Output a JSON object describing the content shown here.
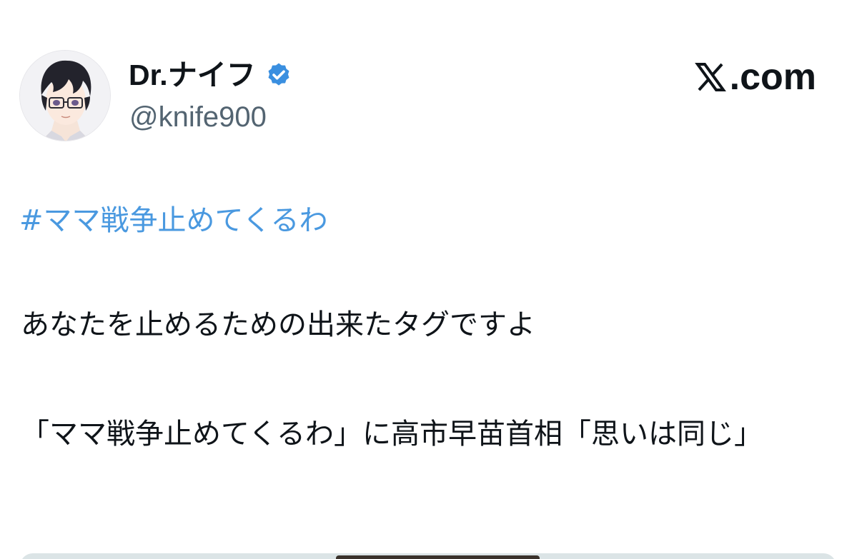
{
  "tweet": {
    "author": {
      "display_name": "Dr.ナイフ",
      "handle": "@knife900",
      "verified": true,
      "avatar_icon": "anime-avatar-icon"
    },
    "brand_text": ".com",
    "brand_icon": "x-logo-icon",
    "hashtag": "#ママ戦争止めてくるわ",
    "paragraphs": [
      "あなたを止めるための出来たタグですよ",
      "「ママ戦争止めてくるわ」に高市早苗首相「思いは同じ」"
    ]
  },
  "colors": {
    "text": "#0f1419",
    "secondary_text": "#536471",
    "link": "#4a99e0",
    "verified_badge": "#3a8fe0"
  }
}
